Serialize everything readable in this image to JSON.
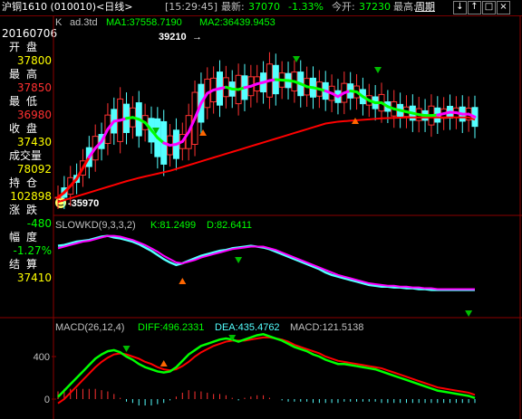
{
  "topbar": {
    "title": "沪铜1610 (010010)<日线>",
    "time": "[15:29:45]",
    "latest_label": "最新:",
    "latest_value": "37070",
    "change_pct": "-1.33%",
    "open_label": "今开:",
    "open_value": "37230",
    "high_label": "最高:",
    "high_value": "周期",
    "controls": [
      "↓",
      "↑",
      "□",
      "×"
    ]
  },
  "sidebar": {
    "date": "20160706",
    "items": [
      {
        "label": "开盘",
        "value": "37800",
        "color": "#ffff00"
      },
      {
        "label": "最高",
        "value": "37850",
        "color": "#ff3030"
      },
      {
        "label": "最低",
        "value": "36980",
        "color": "#ff3030"
      },
      {
        "label": "收盘",
        "value": "37430",
        "color": "#ffff00"
      },
      {
        "label": "成交量",
        "value": "78092",
        "color": "#ffff00"
      },
      {
        "label": "持仓",
        "value": "102898",
        "color": "#ffff00"
      },
      {
        "label": "涨跌",
        "value": "-480",
        "color": "#00ff00"
      },
      {
        "label": "幅度",
        "value": "-1.27%",
        "color": "#00ff00"
      },
      {
        "label": "结算",
        "value": "37410",
        "color": "#ffff00"
      }
    ]
  },
  "kline": {
    "prefix": "K",
    "name": "ad.3td",
    "ma1": "MA1:37558.7190",
    "ma2": "MA2:36439.9453",
    "high_marker": "39210",
    "low_marker": "-35970"
  },
  "slowkd": {
    "name": "SLOWKD(9,3,3,2)",
    "k": "K:81.2499",
    "d": "D:82.6411"
  },
  "macd": {
    "name": "MACD(26,12,4)",
    "diff": "DIFF:496.2331",
    "dea": "DEA:435.4762",
    "macd": "MACD:121.5138",
    "ticks": [
      "400",
      "0"
    ]
  },
  "colors": {
    "up": "#ff3232",
    "down": "#54ffff",
    "ma_red": "#ff0000",
    "ma_magenta": "#ff00ff",
    "ma_green": "#00ff00",
    "k_line": "#54ffff",
    "d_line": "#ff00ff",
    "panel_border": "#8b0000",
    "arrow_up": "#ff6600",
    "arrow_down": "#00bb00"
  },
  "chart_data": {
    "type": "candlestick",
    "ma_fast": [
      35800,
      35900,
      36040,
      36190,
      36420,
      36650,
      36840,
      36980,
      37240,
      37410,
      37430,
      37470,
      37490,
      37450,
      37380,
      37220,
      37060,
      36950,
      36900,
      36920,
      36980,
      37180,
      37470,
      37790,
      38000,
      38070,
      38100,
      38130,
      38090,
      38080,
      38120,
      38150,
      38200,
      38230,
      38270,
      38290,
      38280,
      38270,
      38250,
      38200,
      38140,
      38120,
      38090,
      38050,
      38000,
      37930,
      38010,
      38050,
      38030,
      37930,
      37850,
      37800,
      37800,
      37720,
      37670,
      37640,
      37610,
      37580,
      37550,
      37530,
      37530,
      37540,
      37570,
      37600,
      37590,
      37560,
      37560,
      37500
    ],
    "ma_slow": [
      35700,
      35740,
      35780,
      35820,
      35860,
      35900,
      35940,
      35980,
      36020,
      36060,
      36100,
      36140,
      36175,
      36210,
      36240,
      36270,
      36300,
      36330,
      36360,
      36400,
      36440,
      36480,
      36520,
      36560,
      36600,
      36640,
      36680,
      36720,
      36760,
      36800,
      36840,
      36880,
      36920,
      36960,
      37000,
      37040,
      37080,
      37120,
      37160,
      37200,
      37240,
      37280,
      37320,
      37360,
      37380,
      37400,
      37410,
      37420,
      37430,
      37440,
      37450,
      37460,
      37470,
      37475,
      37480,
      37485,
      37490,
      37490,
      37490,
      37490,
      37490,
      37490,
      37490,
      37490,
      37490,
      37490,
      37490,
      37440
    ],
    "ma_fast_colors": [
      "r",
      "r",
      "r",
      "r",
      "r",
      "m",
      "m",
      "m",
      "m",
      "m",
      "m",
      "g",
      "g",
      "g",
      "g",
      "g",
      "g",
      "m",
      "m",
      "m",
      "m",
      "m",
      "m",
      "m",
      "m",
      "m",
      "m",
      "g",
      "g",
      "g",
      "m",
      "m",
      "m",
      "m",
      "m",
      "g",
      "g",
      "g",
      "g",
      "g",
      "g",
      "g",
      "g",
      "m",
      "m",
      "m",
      "m",
      "g",
      "g",
      "g",
      "g",
      "g",
      "g",
      "g",
      "g",
      "g",
      "g",
      "g",
      "g",
      "g",
      "g",
      "m",
      "m",
      "m",
      "m",
      "m",
      "m",
      "g"
    ],
    "kd_k": [
      83,
      84,
      86,
      88,
      89,
      90,
      92,
      94,
      95,
      93,
      92,
      90,
      88,
      85,
      81,
      77,
      72,
      67,
      63,
      60,
      62,
      65,
      68,
      71,
      73,
      75,
      77,
      78,
      80,
      81,
      82,
      83,
      82,
      81,
      79,
      76,
      73,
      70,
      67,
      64,
      61,
      58,
      55,
      51,
      48,
      46,
      44,
      42,
      40,
      38,
      36,
      35,
      34,
      34,
      33,
      33,
      32,
      32,
      31,
      31,
      30,
      30,
      30,
      30,
      30,
      30,
      30,
      30
    ],
    "kd_d": [
      80,
      82,
      84,
      86,
      88,
      89,
      91,
      93,
      95,
      95,
      94,
      92,
      90,
      87,
      84,
      80,
      76,
      71,
      67,
      63,
      62,
      64,
      66,
      69,
      71,
      73,
      75,
      77,
      79,
      80,
      81,
      82,
      82,
      82,
      80,
      78,
      75,
      72,
      69,
      66,
      63,
      60,
      57,
      54,
      51,
      48,
      46,
      44,
      42,
      40,
      38,
      37,
      36,
      35,
      35,
      34,
      34,
      33,
      33,
      32,
      32,
      31,
      31,
      31,
      31,
      31,
      31,
      31
    ],
    "macd_diff": [
      20,
      80,
      140,
      200,
      260,
      320,
      380,
      420,
      450,
      460,
      440,
      400,
      370,
      330,
      300,
      280,
      260,
      250,
      260,
      300,
      360,
      420,
      460,
      500,
      520,
      540,
      560,
      570,
      560,
      540,
      560,
      580,
      600,
      610,
      590,
      570,
      550,
      520,
      490,
      470,
      450,
      420,
      400,
      370,
      350,
      330,
      330,
      320,
      310,
      300,
      290,
      280,
      260,
      240,
      220,
      200,
      180,
      160,
      140,
      120,
      100,
      80,
      70,
      60,
      50,
      40,
      30,
      10
    ],
    "macd_dea": [
      -40,
      0,
      60,
      120,
      180,
      240,
      300,
      350,
      390,
      420,
      430,
      420,
      400,
      380,
      350,
      330,
      300,
      280,
      270,
      280,
      310,
      350,
      400,
      440,
      470,
      500,
      520,
      540,
      550,
      550,
      550,
      560,
      570,
      580,
      580,
      570,
      560,
      540,
      510,
      490,
      470,
      450,
      430,
      400,
      380,
      360,
      350,
      340,
      330,
      320,
      310,
      300,
      290,
      270,
      250,
      230,
      210,
      190,
      170,
      150,
      130,
      110,
      100,
      90,
      80,
      70,
      60,
      40
    ]
  }
}
